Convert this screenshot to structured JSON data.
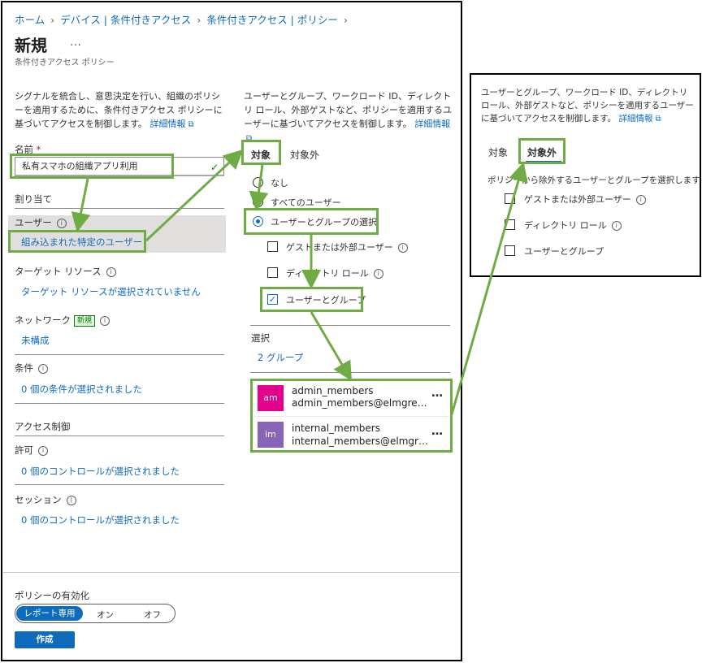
{
  "breadcrumb": [
    "ホーム",
    "デバイス | 条件付きアクセス",
    "条件付きアクセス | ポリシー"
  ],
  "page": {
    "title": "新規",
    "more": "…",
    "subtitle": "条件付きアクセス ポリシー"
  },
  "left": {
    "description": "シグナルを統合し、意思決定を行い、組織のポリシーを適用するために、条件付きアクセス ポリシーに基づいてアクセスを制御します。",
    "learn_more": "詳細情報",
    "name_label": "名前",
    "required_mark": "*",
    "name_value": "私有スマホの組織アプリ利用",
    "assignments_heading": "割り当て",
    "users_label": "ユーザー",
    "users_value": "組み込まれた特定のユーザー",
    "target_label": "ターゲット リソース",
    "target_value": "ターゲット リソースが選択されていません",
    "network_label": "ネットワーク",
    "network_badge": "新規",
    "network_value": "未構成",
    "conditions_label": "条件",
    "conditions_value": "0 個の条件が選択されました",
    "access_heading": "アクセス制御",
    "grant_label": "許可",
    "grant_value": "0 個のコントロールが選択されました",
    "session_label": "セッション",
    "session_value": "0 個のコントロールが選択されました"
  },
  "middle": {
    "description": "ユーザーとグループ、ワークロード ID、ディレクトリ ロール、外部ゲストなど、ポリシーを適用するユーザーに基づいてアクセスを制御します。",
    "learn_more": "詳細情報",
    "tabs": [
      "対象",
      "対象外"
    ],
    "radios": [
      "なし",
      "すべてのユーザー",
      "ユーザーとグループの選択"
    ],
    "checks": [
      "ゲストまたは外部ユーザー",
      "ディレクトリ ロール",
      "ユーザーとグループ"
    ],
    "select_label": "選択",
    "select_value": "2 グループ",
    "members": [
      {
        "initials": "am",
        "name": "admin_members",
        "email": "admin_members@elmgre…",
        "color": "#e3008c"
      },
      {
        "initials": "im",
        "name": "internal_members",
        "email": "internal_members@elmgr…",
        "color": "#8764b8"
      }
    ],
    "more": "…"
  },
  "side": {
    "description": "ユーザーとグループ、ワークロード ID、ディレクトリ ロール、外部ゲストなど、ポリシーを適用するユーザーに基づいてアクセスを制御します。",
    "learn_more": "詳細情報",
    "tabs": [
      "対象",
      "対象外"
    ],
    "instruction": "ポリシーから除外するユーザーとグループを選択します",
    "checks": [
      "ゲストまたは外部ユーザー",
      "ディレクトリ ロール",
      "ユーザーとグループ"
    ]
  },
  "footer": {
    "enable_label": "ポリシーの有効化",
    "toggle": [
      "レポート専用",
      "オン",
      "オフ"
    ],
    "create": "作成"
  },
  "colors": {
    "accent": "#0f6cbd",
    "highlight": "#6fac46",
    "success": "#107c10"
  }
}
